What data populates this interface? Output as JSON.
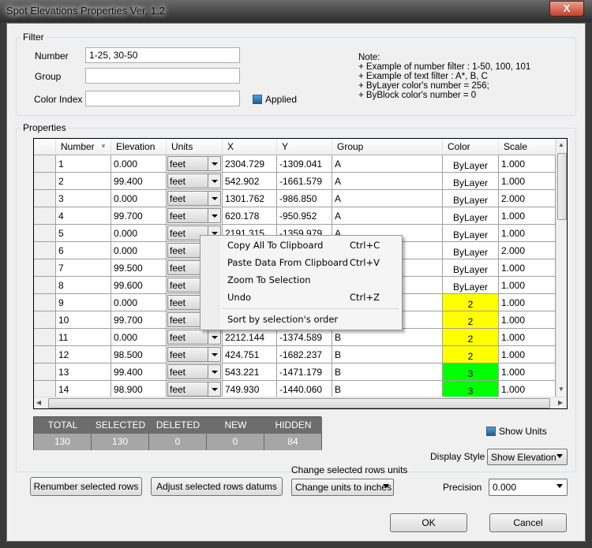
{
  "window": {
    "title": "Spot Elevations Properties Ver. 1.2",
    "close_label": "X"
  },
  "filter": {
    "label": "Filter",
    "number_label": "Number",
    "number_value": "1-25, 30-50",
    "group_label": "Group",
    "group_value": "",
    "color_label": "Color Index",
    "color_value": "",
    "applied_label": "Applied",
    "applied_checked": true,
    "note": [
      "Note:",
      "+ Example of number filter : 1-50, 100, 101",
      "+ Example of text filter : A*, B, C",
      "+ ByLayer color's number = 256;",
      "+ ByBlock color's number = 0"
    ]
  },
  "properties": {
    "label": "Properties",
    "columns": [
      "Number",
      "Elevation",
      "Units",
      "X",
      "Y",
      "Group",
      "Color",
      "Scale"
    ],
    "rows": [
      {
        "number": "1",
        "elevation": "0.000",
        "units": "feet",
        "x": "2304.729",
        "y": "-1309.041",
        "group": "A",
        "color": "ByLayer",
        "color_bg": "#ffffff",
        "scale": "1.000"
      },
      {
        "number": "2",
        "elevation": "99.400",
        "units": "feet",
        "x": "542.902",
        "y": "-1661.579",
        "group": "A",
        "color": "ByLayer",
        "color_bg": "#ffffff",
        "scale": "1.000"
      },
      {
        "number": "3",
        "elevation": "0.000",
        "units": "feet",
        "x": "1301.762",
        "y": "-986.850",
        "group": "A",
        "color": "ByLayer",
        "color_bg": "#ffffff",
        "scale": "2.000"
      },
      {
        "number": "4",
        "elevation": "99.700",
        "units": "feet",
        "x": "620.178",
        "y": "-950.952",
        "group": "A",
        "color": "ByLayer",
        "color_bg": "#ffffff",
        "scale": "1.000"
      },
      {
        "number": "5",
        "elevation": "0.000",
        "units": "feet",
        "x": "2191.315",
        "y": "-1359.979",
        "group": "A",
        "color": "ByLayer",
        "color_bg": "#ffffff",
        "scale": "1.000"
      },
      {
        "number": "6",
        "elevation": "0.000",
        "units": "feet",
        "x": "",
        "y": "",
        "group": "",
        "color": "ByLayer",
        "color_bg": "#ffffff",
        "scale": "2.000"
      },
      {
        "number": "7",
        "elevation": "99.500",
        "units": "feet",
        "x": "",
        "y": "",
        "group": "",
        "color": "ByLayer",
        "color_bg": "#ffffff",
        "scale": "1.000"
      },
      {
        "number": "8",
        "elevation": "99.600",
        "units": "feet",
        "x": "",
        "y": "",
        "group": "",
        "color": "ByLayer",
        "color_bg": "#ffffff",
        "scale": "1.000"
      },
      {
        "number": "9",
        "elevation": "0.000",
        "units": "feet",
        "x": "",
        "y": "",
        "group": "",
        "color": "2",
        "color_bg": "#ffff00",
        "scale": "1.000"
      },
      {
        "number": "10",
        "elevation": "99.700",
        "units": "feet",
        "x": "",
        "y": "",
        "group": "",
        "color": "2",
        "color_bg": "#ffff00",
        "scale": "1.000"
      },
      {
        "number": "11",
        "elevation": "0.000",
        "units": "feet",
        "x": "2212.144",
        "y": "-1374.589",
        "group": "B",
        "color": "2",
        "color_bg": "#ffff00",
        "scale": "1.000"
      },
      {
        "number": "12",
        "elevation": "98.500",
        "units": "feet",
        "x": "424.751",
        "y": "-1682.237",
        "group": "B",
        "color": "2",
        "color_bg": "#ffff00",
        "scale": "1.000"
      },
      {
        "number": "13",
        "elevation": "99.400",
        "units": "feet",
        "x": "543.221",
        "y": "-1471.179",
        "group": "B",
        "color": "3",
        "color_bg": "#00ff00",
        "scale": "1.000"
      },
      {
        "number": "14",
        "elevation": "98.900",
        "units": "feet",
        "x": "749.930",
        "y": "-1440.060",
        "group": "B",
        "color": "3",
        "color_bg": "#00ff00",
        "scale": "1.000"
      }
    ]
  },
  "context_menu": [
    {
      "label": "Copy All To Clipboard",
      "shortcut": "Ctrl+C"
    },
    {
      "label": "Paste Data From Clipboard",
      "shortcut": "Ctrl+V"
    },
    {
      "label": "Zoom To Selection",
      "shortcut": ""
    },
    {
      "label": "Undo",
      "shortcut": "Ctrl+Z"
    },
    {
      "label": "Sort by selection's order",
      "shortcut": ""
    }
  ],
  "stats": {
    "headers": [
      "TOTAL",
      "SELECTED",
      "DELETED",
      "NEW",
      "HIDDEN"
    ],
    "values": [
      "130",
      "130",
      "0",
      "0",
      "84"
    ]
  },
  "options": {
    "show_units_label": "Show Units",
    "show_units_checked": true,
    "display_style_label": "Display Style",
    "display_style_value": "Show Elevation",
    "change_units_label": "Change selected rows units",
    "change_units_value": "Change units to inches",
    "precision_label": "Precision",
    "precision_value": "0.000"
  },
  "buttons": {
    "renumber": "Renumber selected rows",
    "adjust": "Adjust selected rows datums",
    "ok": "OK",
    "cancel": "Cancel"
  }
}
